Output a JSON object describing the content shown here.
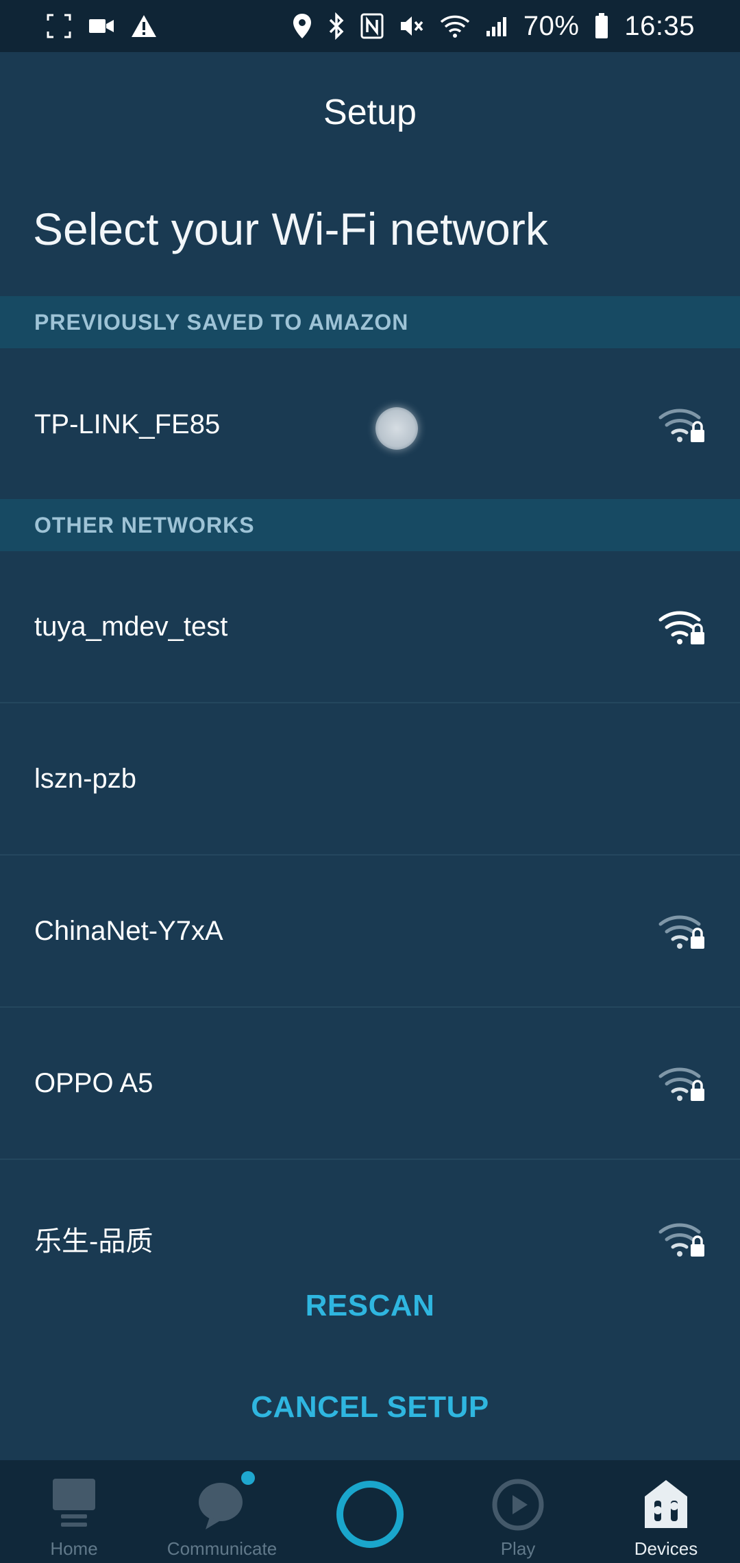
{
  "status_bar": {
    "battery": "70%",
    "time": "16:35",
    "left_icons": [
      "screenshot-icon",
      "video-icon",
      "warning-icon"
    ],
    "right_icons": [
      "location-icon",
      "bluetooth-icon",
      "nfc-icon",
      "mute-icon",
      "wifi-icon",
      "signal-icon",
      "battery-icon"
    ]
  },
  "header": {
    "title": "Setup"
  },
  "prompt": "Select your Wi-Fi network",
  "sections": {
    "saved": "PREVIOUSLY SAVED TO AMAZON",
    "other": "OTHER NETWORKS"
  },
  "networks": {
    "saved": [
      {
        "name": "TP-LINK_FE85",
        "icon": "wifi-lock-icon",
        "strength": "weak"
      }
    ],
    "other": [
      {
        "name": "tuya_mdev_test",
        "icon": "wifi-lock-icon",
        "strength": "strong"
      },
      {
        "name": "lszn-pzb",
        "icon": "",
        "strength": "none"
      },
      {
        "name": "ChinaNet-Y7xA",
        "icon": "wifi-lock-icon",
        "strength": "weak"
      },
      {
        "name": "OPPO A5",
        "icon": "wifi-lock-icon",
        "strength": "weak"
      },
      {
        "name": "乐生-品质",
        "icon": "wifi-lock-icon",
        "strength": "weak"
      }
    ]
  },
  "actions": {
    "rescan": "RESCAN",
    "cancel": "CANCEL SETUP"
  },
  "nav": {
    "items": [
      {
        "label": "Home",
        "icon": "home-icon"
      },
      {
        "label": "Communicate",
        "icon": "chat-icon"
      },
      {
        "label": "",
        "icon": "alexa-icon"
      },
      {
        "label": "Play",
        "icon": "play-icon"
      },
      {
        "label": "Devices",
        "icon": "devices-icon"
      }
    ]
  },
  "colors": {
    "background": "#1a3a52",
    "section_header_bg": "#174a63",
    "accent": "#2fb6e0",
    "nav_bg": "#10283a"
  }
}
